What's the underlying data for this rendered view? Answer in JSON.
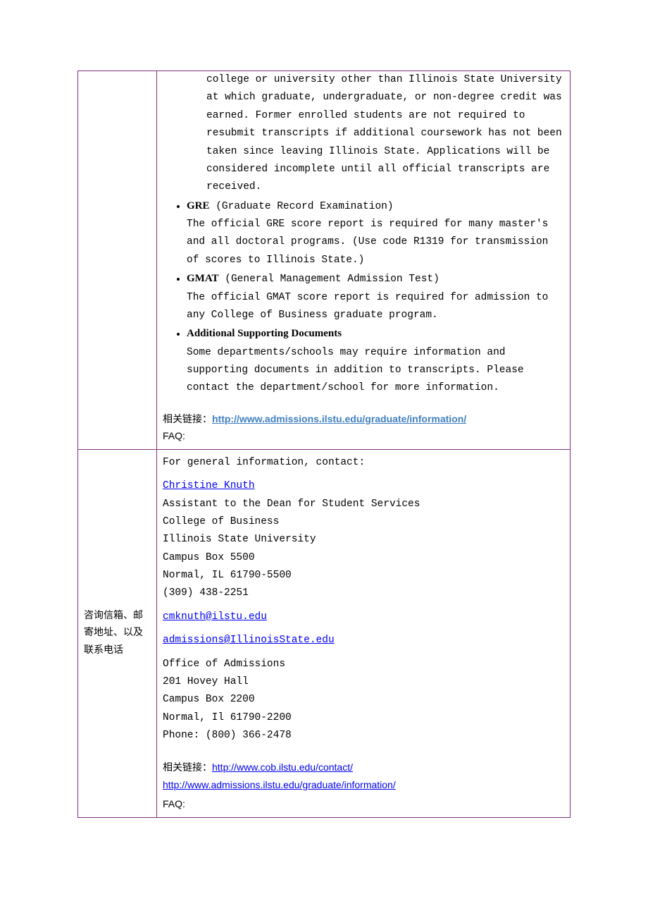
{
  "row1": {
    "label": "",
    "transcript_cont": "college or university other than Illinois State University at which graduate, undergraduate, or non-degree credit was earned. Former enrolled students are not required to resubmit transcripts if additional coursework has not been taken since leaving Illinois State.   Applications will be considered incomplete until all official transcripts are received.",
    "gre_title": "GRE",
    "gre_sub": " (Graduate Record Examination)",
    "gre_body": "The official GRE score report is required for many master's and all doctoral programs. (Use code R1319 for transmission of scores to Illinois State.)",
    "gmat_title": "GMAT",
    "gmat_sub": " (General Management Admission Test)",
    "gmat_body": "The official GMAT score report is required for admission to any College of Business graduate program.",
    "add_title": "Additional Supporting Documents",
    "add_body": "Some departments/schools may require information and supporting documents in addition to transcripts. Please contact the department/school for more information.",
    "link_label": "相关链接：",
    "link_url": "http://www.admissions.ilstu.edu/graduate/information/",
    "faq": "FAQ:"
  },
  "row2": {
    "label": "咨询信箱、邮寄地址、以及联系电话",
    "intro": "For general information, contact:",
    "name": "Christine Knuth",
    "title": "Assistant to the Dean for Student Services",
    "org1": "College of Business",
    "org2": "Illinois State University",
    "addr1": "Campus Box 5500",
    "addr2": "Normal, IL 61790-5500",
    "phone1": "(309) 438-2251",
    "email1": "cmknuth@ilstu.edu",
    "email2": "admissions@IllinoisState.edu",
    "off1": "Office of Admissions",
    "off2": "201 Hovey Hall",
    "off3": "Campus Box 2200",
    "off4": "Normal, Il 61790-2200",
    "off5": "Phone: (800) 366-2478",
    "link_label": "相关链接：",
    "link1": "http://www.cob.ilstu.edu/contact/",
    "link2": "http://www.admissions.ilstu.edu/graduate/information/",
    "faq": "FAQ:"
  }
}
